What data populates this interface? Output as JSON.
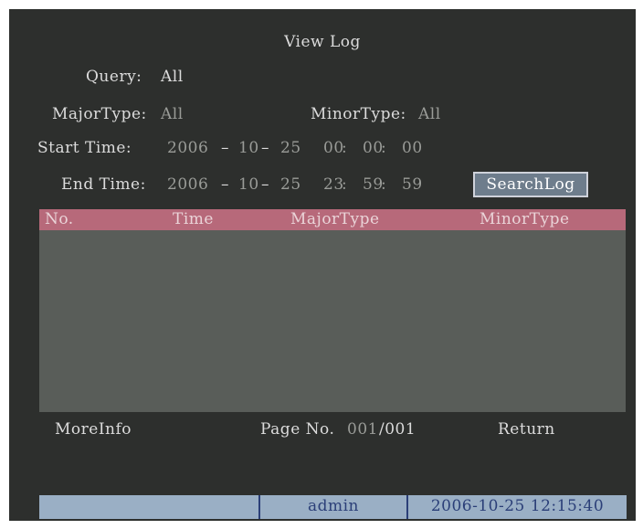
{
  "title": "View Log",
  "query": {
    "label": "Query:",
    "value": "All"
  },
  "major_type": {
    "label": "MajorType:",
    "value": "All"
  },
  "minor_type": {
    "label": "MinorType:",
    "value": "All"
  },
  "start_time": {
    "label": "Start Time:",
    "year": "2006",
    "month": "10",
    "day": "25",
    "hour": "00",
    "minute": "00",
    "second": "00"
  },
  "end_time": {
    "label": "End Time:",
    "year": "2006",
    "month": "10",
    "day": "25",
    "hour": "23",
    "minute": "59",
    "second": "59"
  },
  "date_sep": "–",
  "time_sep": ":",
  "search_button": "SearchLog",
  "table": {
    "columns": [
      "No.",
      "Time",
      "MajorType",
      "MinorType"
    ],
    "rows": []
  },
  "footer": {
    "more_info": "MoreInfo",
    "page_label": "Page No.",
    "page_current": "001",
    "page_total": "/001",
    "return": "Return"
  },
  "status_bar": {
    "user": "admin",
    "datetime": "2006-10-25 12:15:40"
  },
  "colors": {
    "background": "#2d2f2d",
    "header_row": "#b7697a",
    "table_body": "#595d59",
    "status_bar": "#9aafc5",
    "button": "#6e7d8c"
  }
}
